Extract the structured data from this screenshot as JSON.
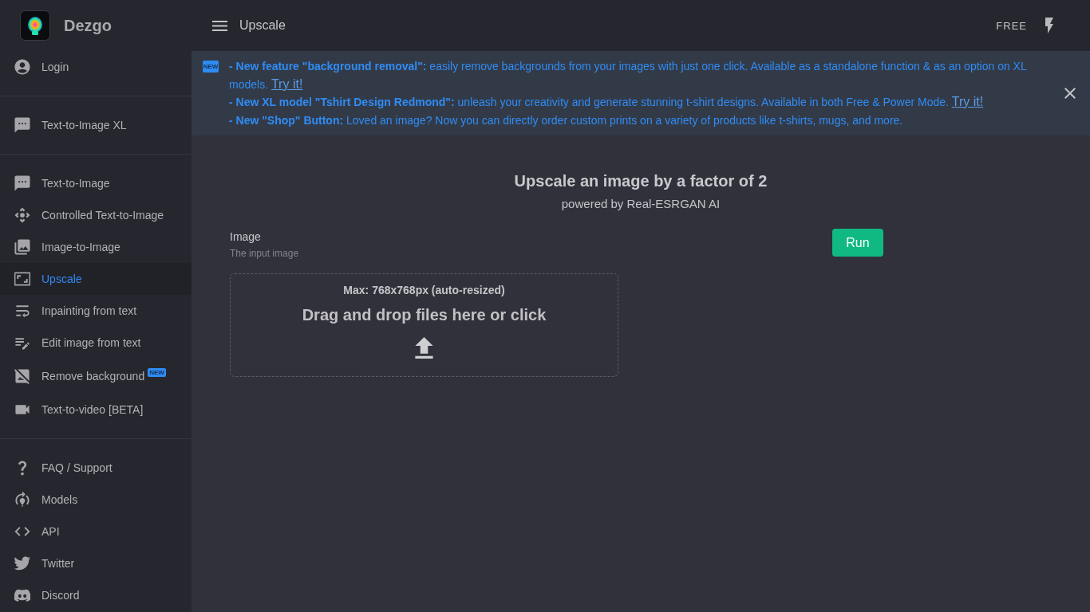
{
  "sidebar": {
    "brand": "Dezgo",
    "groups": [
      {
        "items": [
          {
            "label": "Login",
            "selected": false
          }
        ]
      },
      {
        "items": [
          {
            "label": "Text-to-Image XL",
            "selected": false
          }
        ]
      },
      {
        "items": [
          {
            "label": "Text-to-Image",
            "selected": false
          },
          {
            "label": "Controlled Text-to-Image",
            "selected": false
          },
          {
            "label": "Image-to-Image",
            "selected": false
          },
          {
            "label": "Upscale",
            "selected": true
          },
          {
            "label": "Inpainting from text",
            "selected": false
          },
          {
            "label": "Edit image from text",
            "selected": false
          },
          {
            "label": "Remove background",
            "selected": false,
            "badge": "NEW"
          },
          {
            "label": "Text-to-video [BETA]",
            "selected": false
          }
        ]
      },
      {
        "items": [
          {
            "label": "FAQ / Support",
            "selected": false
          },
          {
            "label": "Models",
            "selected": false
          },
          {
            "label": "API",
            "selected": false
          },
          {
            "label": "Twitter",
            "selected": false
          },
          {
            "label": "Discord",
            "selected": false
          }
        ]
      }
    ]
  },
  "top_bar": {
    "title": "Upscale",
    "plan": "FREE"
  },
  "announcement": {
    "badge": "NEW",
    "lines": [
      {
        "text": "**- New feature \"background removal\":** easily remove backgrounds from your images with just one click. Available as a standalone function & as an option on XL models.",
        "link": "Try it!"
      },
      {
        "text": "**- New XL model \"Tshirt Design Redmond\":** unleash your creativity and generate stunning t-shirt designs. Available in both Free & Power Mode.",
        "link": "Try it!"
      },
      {
        "text": "**- New \"Shop\" Button:** Loved an image? Now you can directly order custom prints on a variety of products like t-shirts, mugs, and more."
      }
    ]
  },
  "tool": {
    "title": "Upscale an image by a factor of 2",
    "subtitle": "powered by Real-ESRGAN AI",
    "field": {
      "label": "Image",
      "hint": "The input image"
    },
    "dropzone": {
      "limit": "Max: 768x768px (auto-resized)",
      "prompt": "Drag and drop files here or click"
    },
    "run_button": "Run"
  }
}
